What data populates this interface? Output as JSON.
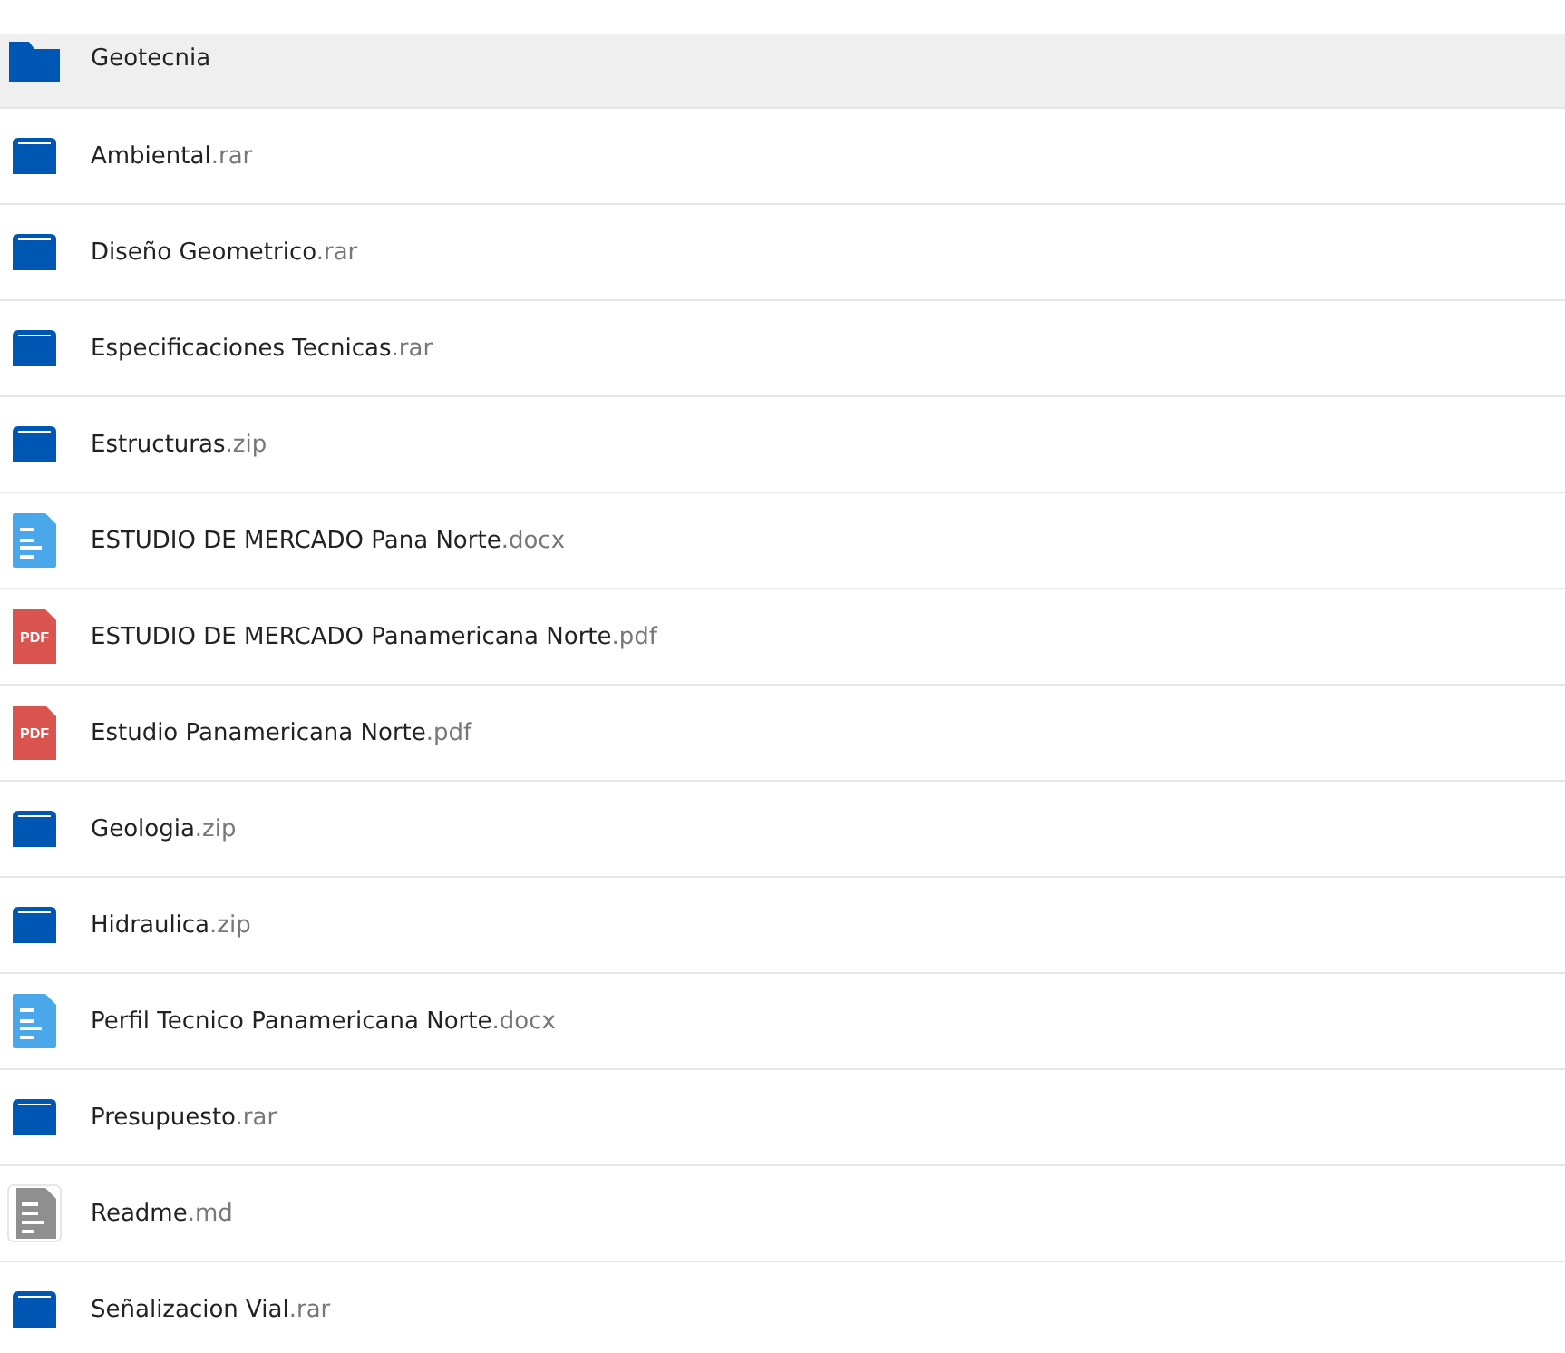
{
  "files": [
    {
      "kind": "folder",
      "name": "Geotecnia",
      "highlighted": true
    },
    {
      "kind": "archive",
      "name": "Ambiental",
      "extension": ".rar",
      "highlighted": false
    },
    {
      "kind": "archive",
      "name": "Diseño Geometrico",
      "extension": ".rar",
      "highlighted": false
    },
    {
      "kind": "archive",
      "name": "Especificaciones Tecnicas",
      "extension": ".rar",
      "highlighted": false
    },
    {
      "kind": "archive",
      "name": "Estructuras",
      "extension": ".zip",
      "highlighted": false
    },
    {
      "kind": "document",
      "name": "ESTUDIO DE MERCADO Pana Norte",
      "extension": ".docx",
      "highlighted": false
    },
    {
      "kind": "pdf",
      "badge": "PDF",
      "name": "ESTUDIO DE MERCADO Panamericana Norte",
      "extension": ".pdf",
      "highlighted": false
    },
    {
      "kind": "pdf",
      "badge": "PDF",
      "name": "Estudio Panamericana Norte",
      "extension": ".pdf",
      "highlighted": false
    },
    {
      "kind": "archive",
      "name": "Geologia",
      "extension": ".zip",
      "highlighted": false
    },
    {
      "kind": "archive",
      "name": "Hidraulica",
      "extension": ".zip",
      "highlighted": false
    },
    {
      "kind": "document",
      "name": "Perfil Tecnico Panamericana Norte",
      "extension": ".docx",
      "highlighted": false
    },
    {
      "kind": "archive",
      "name": "Presupuesto",
      "extension": ".rar",
      "highlighted": false
    },
    {
      "kind": "text",
      "name": "Readme",
      "extension": ".md",
      "highlighted": false
    },
    {
      "kind": "archive",
      "name": "Señalizacion Vial",
      "extension": ".rar",
      "highlighted": false
    }
  ]
}
